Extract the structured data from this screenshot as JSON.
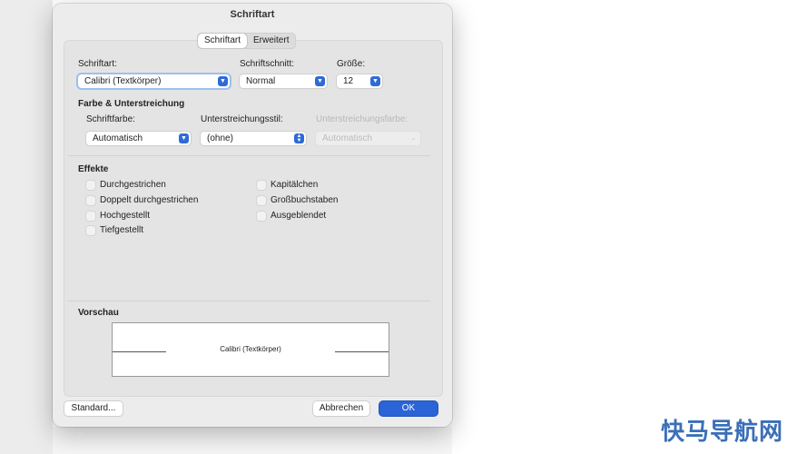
{
  "dialog": {
    "title": "Schriftart"
  },
  "tabs": [
    {
      "label": "Schriftart",
      "active": true
    },
    {
      "label": "Erweitert",
      "active": false
    }
  ],
  "font": {
    "label": "Schriftart:",
    "value": "Calibri (Textkörper)",
    "style_label": "Schriftschnitt:",
    "style_value": "Normal",
    "size_label": "Größe:",
    "size_value": "12"
  },
  "color_underline": {
    "heading": "Farbe & Unterstreichung",
    "color_label": "Schriftfarbe:",
    "color_value": "Automatisch",
    "underline_label": "Unterstreichungsstil:",
    "underline_value": "(ohne)",
    "underline_color_label": "Unterstreichungsfarbe:",
    "underline_color_value": "Automatisch"
  },
  "effects": {
    "heading": "Effekte",
    "left": [
      {
        "label": "Durchgestrichen",
        "checked": false
      },
      {
        "label": "Doppelt durchgestrichen",
        "checked": false
      },
      {
        "label": "Hochgestellt",
        "checked": false
      },
      {
        "label": "Tiefgestellt",
        "checked": false
      }
    ],
    "right": [
      {
        "label": "Kapitälchen",
        "checked": false
      },
      {
        "label": "Großbuchstaben",
        "checked": false
      },
      {
        "label": "Ausgeblendet",
        "checked": false
      }
    ]
  },
  "preview": {
    "heading": "Vorschau",
    "sample": "Calibri (Textkörper)"
  },
  "buttons": {
    "default": "Standard...",
    "cancel": "Abbrechen",
    "ok": "OK"
  },
  "watermark": "快马导航网",
  "colors": {
    "accent": "#2a64d6",
    "dialog_bg": "#ececec"
  }
}
